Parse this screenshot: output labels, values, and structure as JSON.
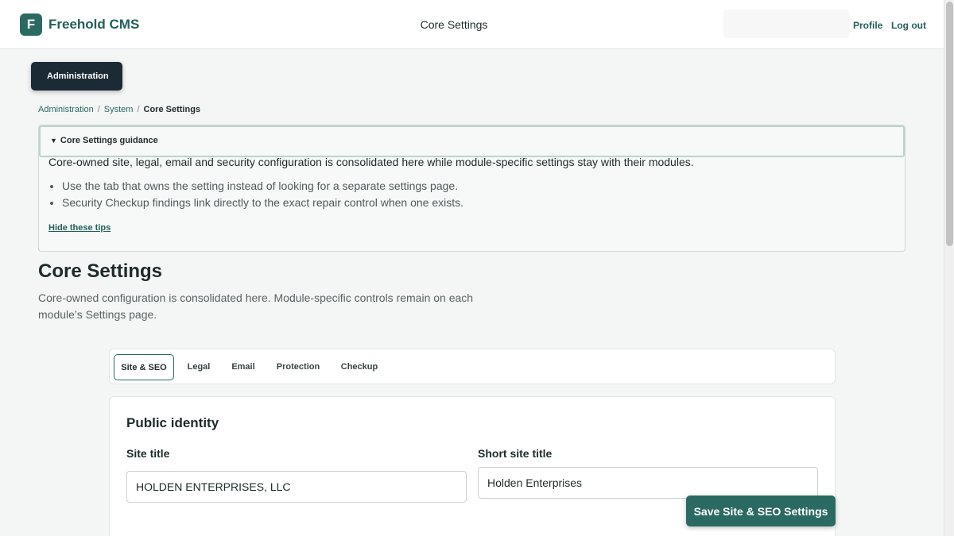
{
  "header": {
    "logo_letter": "F",
    "brand": "Freehold CMS",
    "page_heading": "Core Settings",
    "profile_link": "Profile",
    "logout_link": "Log out"
  },
  "admin_badge": "Administration",
  "breadcrumb": {
    "items": [
      "Administration",
      "System"
    ],
    "current": "Core Settings",
    "separator": "/"
  },
  "guidance": {
    "summary": "Core Settings guidance",
    "intro": "Core-owned site, legal, email and security configuration is consolidated here while module-specific settings stay with their modules.",
    "tips": [
      "Use the tab that owns the setting instead of looking for a separate settings page.",
      "Security Checkup findings link directly to the exact repair control when one exists."
    ],
    "hide_label": "Hide these tips"
  },
  "main": {
    "title": "Core Settings",
    "description": "Core-owned configuration is consolidated here. Module-specific controls remain on each module’s Settings page."
  },
  "tabs": [
    {
      "label": "Site & SEO",
      "active": true
    },
    {
      "label": "Legal",
      "active": false
    },
    {
      "label": "Email",
      "active": false
    },
    {
      "label": "Protection",
      "active": false
    },
    {
      "label": "Checkup",
      "active": false
    }
  ],
  "form": {
    "section_title": "Public identity",
    "site_title": {
      "label": "Site title",
      "value": "HOLDEN ENTERPRISES, LLC"
    },
    "short_site_title": {
      "label": "Short site title",
      "value": "Holden Enterprises"
    }
  },
  "save_button": "Save Site & SEO Settings",
  "colors": {
    "accent": "#2b6a63",
    "badge_bg": "#1c2a36",
    "guidance_bg": "#f6f9f8"
  }
}
